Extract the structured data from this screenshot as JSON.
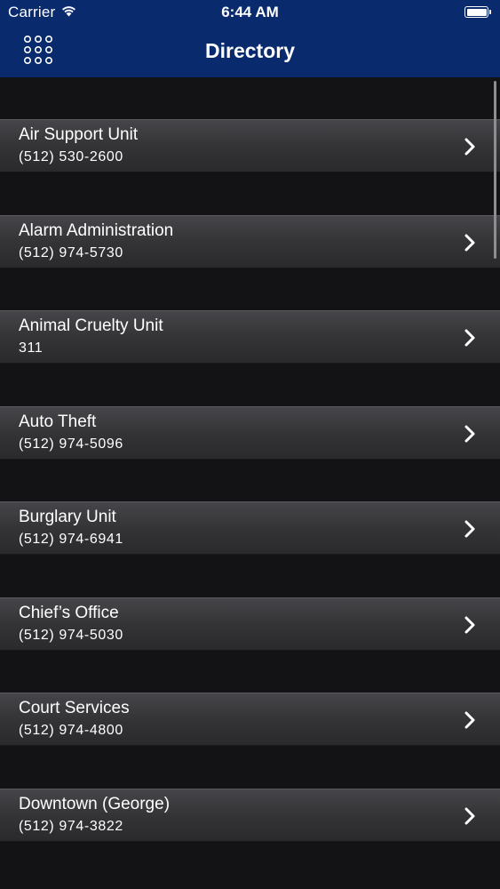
{
  "status_bar": {
    "carrier": "Carrier",
    "time": "6:44 AM",
    "wifi_icon": "wifi-icon",
    "battery_icon": "battery-icon",
    "battery_level_percent": 100
  },
  "nav_bar": {
    "title": "Directory",
    "menu_icon": "grid-menu-icon",
    "background_color": "#0a2a6e"
  },
  "directory": {
    "items": [
      {
        "name": "Air Support Unit",
        "phone": "(512) 530-2600"
      },
      {
        "name": "Alarm Administration",
        "phone": "(512) 974-5730"
      },
      {
        "name": "Animal Cruelty Unit",
        "phone": "311"
      },
      {
        "name": "Auto Theft",
        "phone": "(512) 974-5096"
      },
      {
        "name": "Burglary Unit",
        "phone": "(512) 974-6941"
      },
      {
        "name": "Chief’s Office",
        "phone": "(512) 974-5030"
      },
      {
        "name": "Court Services",
        "phone": "(512) 974-4800"
      },
      {
        "name": "Downtown (George)",
        "phone": "(512) 974-3822"
      }
    ],
    "row_icon": "chevron-right-icon"
  }
}
